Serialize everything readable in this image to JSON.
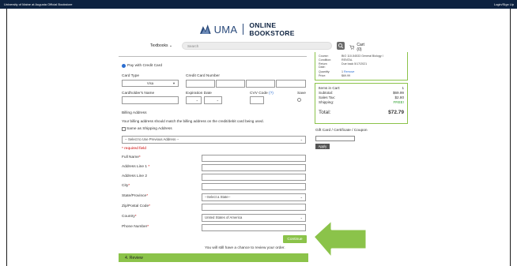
{
  "topbar": {
    "store_name": "University of Maine at Augusta Official Bookstore",
    "login": "Login/Sign Up"
  },
  "header": {
    "logo_text": "UMA",
    "store_title": "ONLINE BOOKSTORE"
  },
  "nav": {
    "textbooks": "Textbooks",
    "search_placeholder": "Search",
    "cart": "Cart (0)"
  },
  "payment": {
    "pay_option": "Pay with Credit Card",
    "card_type_label": "Card Type",
    "card_type_value": "Visa",
    "card_number_label": "Credit Card Number",
    "cardholder_label": "Cardholder's Name",
    "expiration_label": "Expiration Date",
    "cvv_label": "CVV Code",
    "cvv_help": "(?)",
    "save_label": "Save"
  },
  "billing": {
    "title": "Billing Address",
    "note": "Your billing address should match the billing address on the credit/debit card being used.",
    "same_as_shipping": "Same as Shipping Address",
    "previous_address": "-- Select to Use Previous Address --",
    "required_note": "* required field",
    "fields": {
      "full_name": "Full Name",
      "address1": "Address Line 1",
      "address2": "Address Line 2",
      "city": "City",
      "state": "State/Province",
      "zip": "Zip/Postal Code",
      "country": "Country",
      "phone": "Phone Number"
    },
    "asterisk": "*",
    "state_value": "--Select a State--",
    "country_value": "United States of America"
  },
  "actions": {
    "continue": "Continue",
    "review_note": "You will still have a chance to review your order.",
    "next_step": "4. Review"
  },
  "summary": {
    "course_label": "Course:",
    "course_value": "BIO 110-54533 General Biology I",
    "condition_label": "Condition:",
    "condition_value": "RENTAL",
    "return_label": "Return Date:",
    "return_value": "Due back 5/17/2021",
    "quantity_label": "Quantity:",
    "quantity_value": "1",
    "remove": "Remove",
    "price_label": "Price:",
    "price_value": "$69.99",
    "items_label": "Items in Cart:",
    "items_value": "1",
    "subtotal_label": "Subtotal:",
    "subtotal_value": "$69.99",
    "tax_label": "Sales Tax:",
    "tax_value": "$2.80",
    "shipping_label": "Shipping:",
    "shipping_value": "FREE!",
    "total_label": "Total:",
    "total_value": "$72.79"
  },
  "gift": {
    "label": "Gift Card / Certificate / Coupon",
    "apply": "Apply"
  },
  "colors": {
    "topbar": "#0d2240",
    "accent_green": "#8bc34a",
    "arrow_green": "#8bc34a",
    "link_blue": "#2b6ed1",
    "required_red": "#cc0000"
  }
}
